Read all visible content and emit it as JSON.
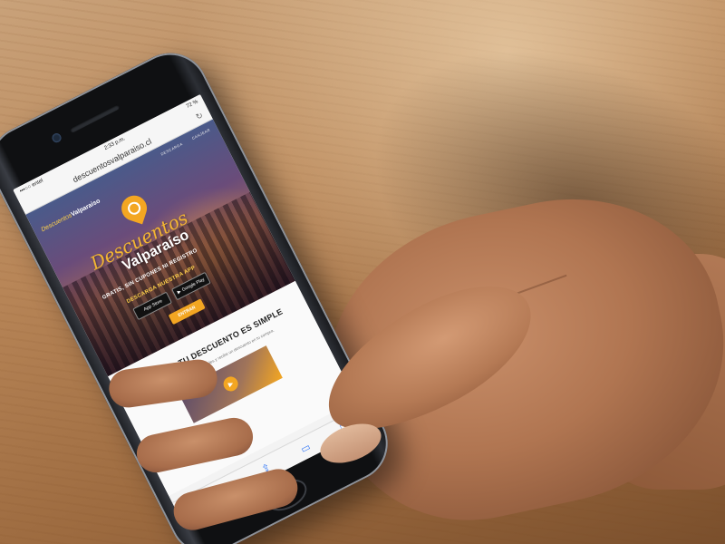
{
  "scene": {
    "description_colors": {
      "wood": "#b88658",
      "skin": "#b07551",
      "accent": "#f3a622"
    }
  },
  "status_bar": {
    "carrier": "•••○○ entel",
    "time": "2:33 p.m.",
    "battery": "72 %"
  },
  "browser": {
    "url": "descuentosvalparaiso.cl",
    "reload_icon": "reload-icon"
  },
  "hero": {
    "nav_items": [
      "DESCARGA",
      "CANJEAR"
    ],
    "brand_script": "Descuentos",
    "brand_bold": "Valparaiso",
    "title_script": "Descuentos",
    "title_bold": "Valparaíso",
    "subtitle": "GRATIS, SIN CUPONES NI REGISTRO",
    "cta": "DESCARGA NUESTRA APP",
    "app_store_label": "App Store",
    "google_play_label": "Google Play",
    "enter_label": "ENTRAR"
  },
  "section": {
    "title": "CANJEAR TU DESCUENTO ES SIMPLE",
    "text": "Compártelo en tus redes sociales y recibe un descuento en tu compra."
  },
  "toolbar": {
    "back_icon": "‹",
    "forward_icon": "›",
    "share_icon": "⇪",
    "bookmarks_icon": "▭",
    "tabs_icon": "❐"
  }
}
